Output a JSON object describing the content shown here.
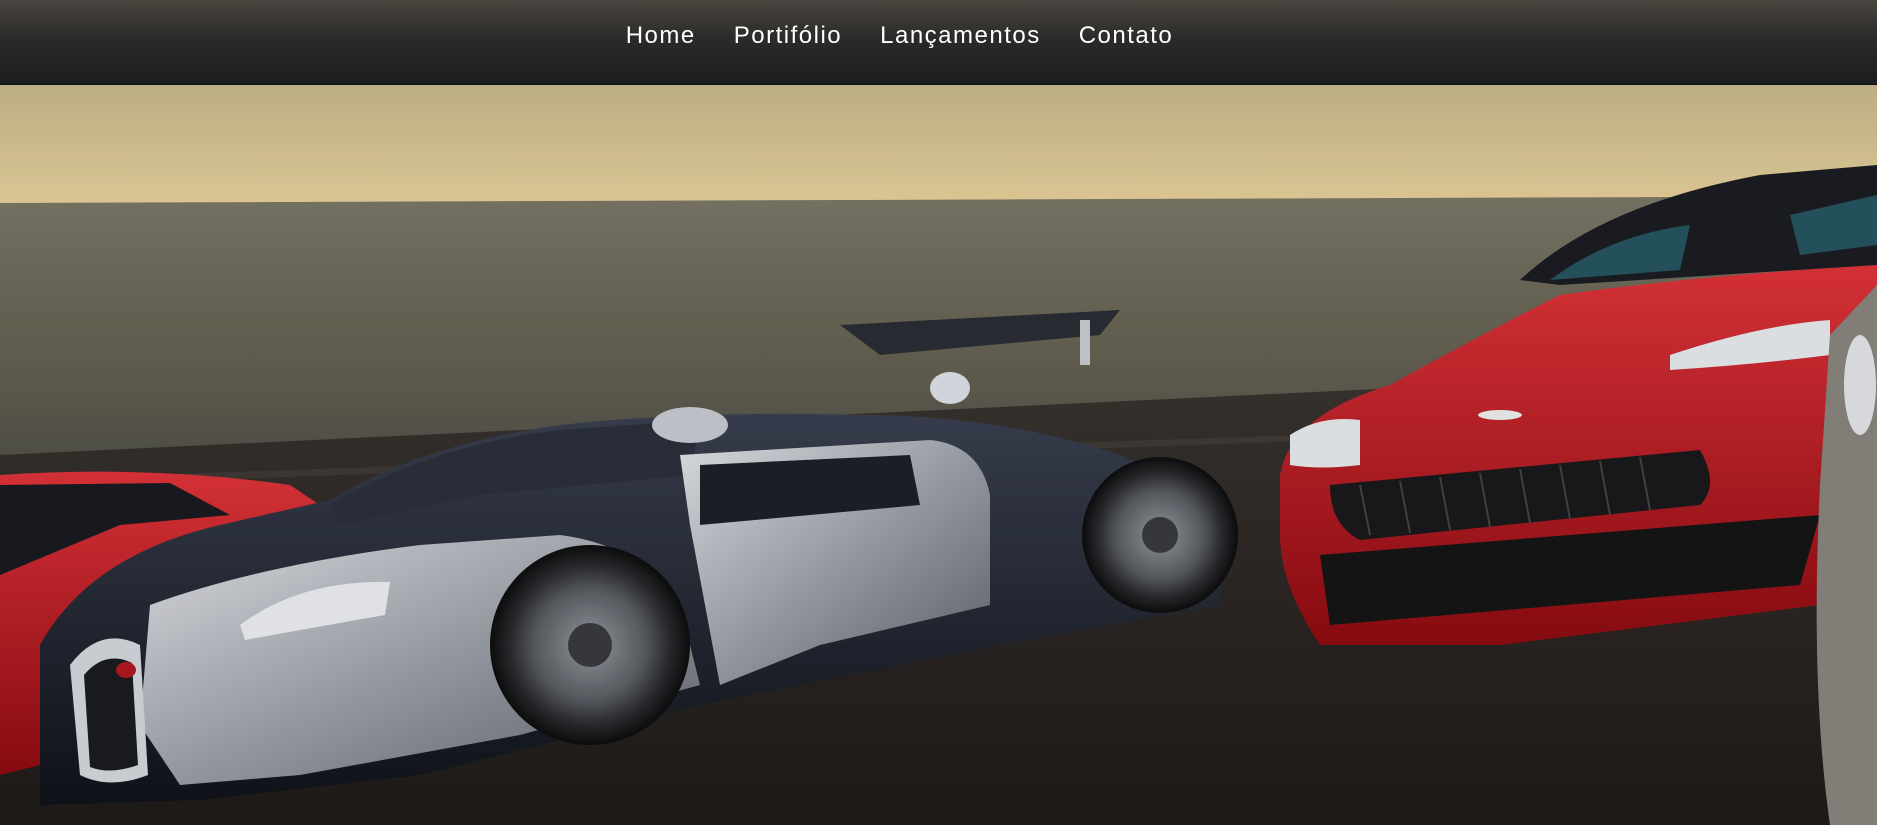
{
  "nav": {
    "items": [
      {
        "label": "Home"
      },
      {
        "label": "Portifólio"
      },
      {
        "label": "Lançamentos"
      },
      {
        "label": "Contato"
      }
    ]
  },
  "hero": {
    "image_subject": "supercars racing on coastal track",
    "colors": {
      "sky_top": "#c9b88a",
      "sky_horizon": "#e6cf98",
      "sea": "#6d6a5a",
      "track": "#2d2925",
      "car_silver": "#b8bcc4",
      "car_black": "#1c202b",
      "car_red": "#c4121a"
    }
  }
}
